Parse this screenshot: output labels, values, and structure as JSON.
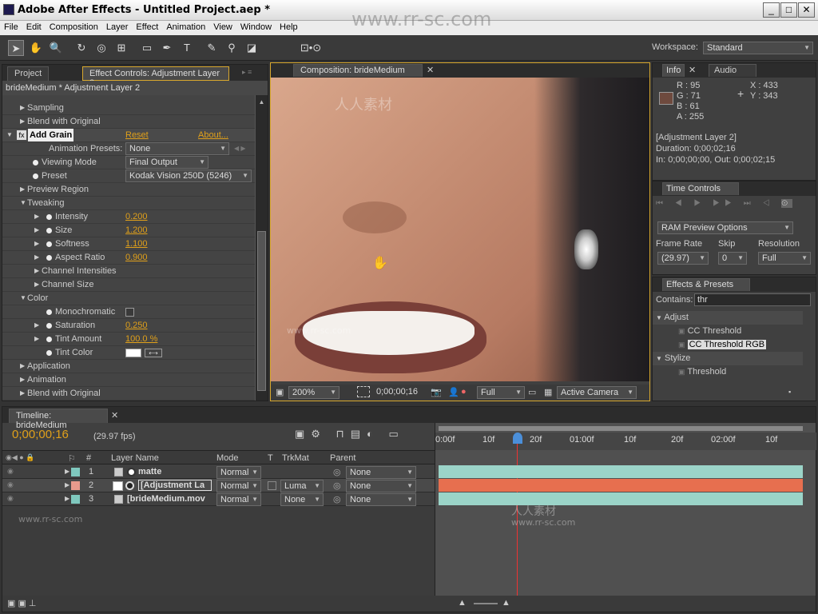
{
  "window": {
    "title": "Adobe After Effects - Untitled Project.aep *",
    "min": "_",
    "max": "□",
    "close": "✕"
  },
  "menu": [
    "File",
    "Edit",
    "Composition",
    "Layer",
    "Effect",
    "Animation",
    "View",
    "Window",
    "Help"
  ],
  "toolbar": {
    "workspace_label": "Workspace:",
    "workspace_value": "Standard"
  },
  "watermark_url": "www.rr-sc.com",
  "effect_panel": {
    "tab_project": "Project",
    "tab_effect": "Effect Controls: Adjustment Layer 2",
    "subtitle": "brideMedium * Adjustment Layer 2",
    "rows": [
      {
        "label": "Sampling"
      },
      {
        "label": "Blend with Original"
      }
    ],
    "effect_name": "Add Grain",
    "reset": "Reset",
    "about": "About...",
    "anim_presets_label": "Animation Presets:",
    "anim_presets_value": "None",
    "viewing_mode_label": "Viewing Mode",
    "viewing_mode_value": "Final Output",
    "preset_label": "Preset",
    "preset_value": "Kodak Vision 250D (5246)",
    "preview_region": "Preview Region",
    "tweaking": "Tweaking",
    "intensity_label": "Intensity",
    "intensity_value": "0.200",
    "size_label": "Size",
    "size_value": "1.200",
    "softness_label": "Softness",
    "softness_value": "1.100",
    "aspect_label": "Aspect Ratio",
    "aspect_value": "0.900",
    "channel_intensities": "Channel Intensities",
    "channel_size": "Channel Size",
    "color": "Color",
    "monochromatic": "Monochromatic",
    "saturation_label": "Saturation",
    "saturation_value": "0.250",
    "tint_amount_label": "Tint Amount",
    "tint_amount_value": "100.0 %",
    "tint_color_label": "Tint Color",
    "application": "Application",
    "animation": "Animation",
    "blend2": "Blend with Original"
  },
  "comp": {
    "tab": "Composition: brideMedium",
    "zoom": "200%",
    "timecode": "0;00;00;16",
    "resolution": "Full",
    "camera": "Active Camera"
  },
  "info": {
    "tab_info": "Info",
    "tab_audio": "Audio",
    "r": "R : 95",
    "g": "G : 71",
    "b": "B : 61",
    "a": "A : 255",
    "x": "X : 433",
    "y": "Y : 343",
    "layer": "[Adjustment Layer 2]",
    "duration": "Duration: 0;00;02;16",
    "inout": "In: 0;00;00;00, Out: 0;00;02;15",
    "swatch": "#6e4a3e"
  },
  "time_controls": {
    "tab": "Time Controls",
    "ram_preview": "RAM Preview Options",
    "frame_rate_label": "Frame Rate",
    "frame_rate_value": "(29.97)",
    "skip_label": "Skip",
    "skip_value": "0",
    "resolution_label": "Resolution",
    "resolution_value": "Full"
  },
  "effects_presets": {
    "tab": "Effects & Presets",
    "contains_label": "Contains:",
    "contains_value": "thr",
    "cat1": "Adjust",
    "item1": "CC Threshold",
    "item2": "CC Threshold RGB",
    "cat2": "Stylize",
    "item3": "Threshold"
  },
  "timeline": {
    "tab": "Timeline: brideMedium",
    "timecode": "0;00;00;16",
    "fps": "(29.97 fps)",
    "col_hash": "#",
    "col_layer": "Layer Name",
    "col_mode": "Mode",
    "col_t": "T",
    "col_trkmat": "TrkMat",
    "col_parent": "Parent",
    "ruler": [
      "0:00f",
      "10f",
      "20f",
      "01:00f",
      "10f",
      "20f",
      "02:00f",
      "10f"
    ],
    "layers": [
      {
        "num": "1",
        "name": "matte",
        "mode": "Normal",
        "trkmat": "",
        "parent": "None",
        "color": "#7fc8be",
        "bar": "#9bd4c8"
      },
      {
        "num": "2",
        "name": "[Adjustment La",
        "mode": "Normal",
        "trkmat": "Luma",
        "parent": "None",
        "color": "#e89a8c",
        "bar": "#e76f4f"
      },
      {
        "num": "3",
        "name": "[brideMedium.mov",
        "mode": "Normal",
        "trkmat": "None",
        "parent": "None",
        "color": "#7fc8be",
        "bar": "#9bd4c8"
      }
    ]
  }
}
